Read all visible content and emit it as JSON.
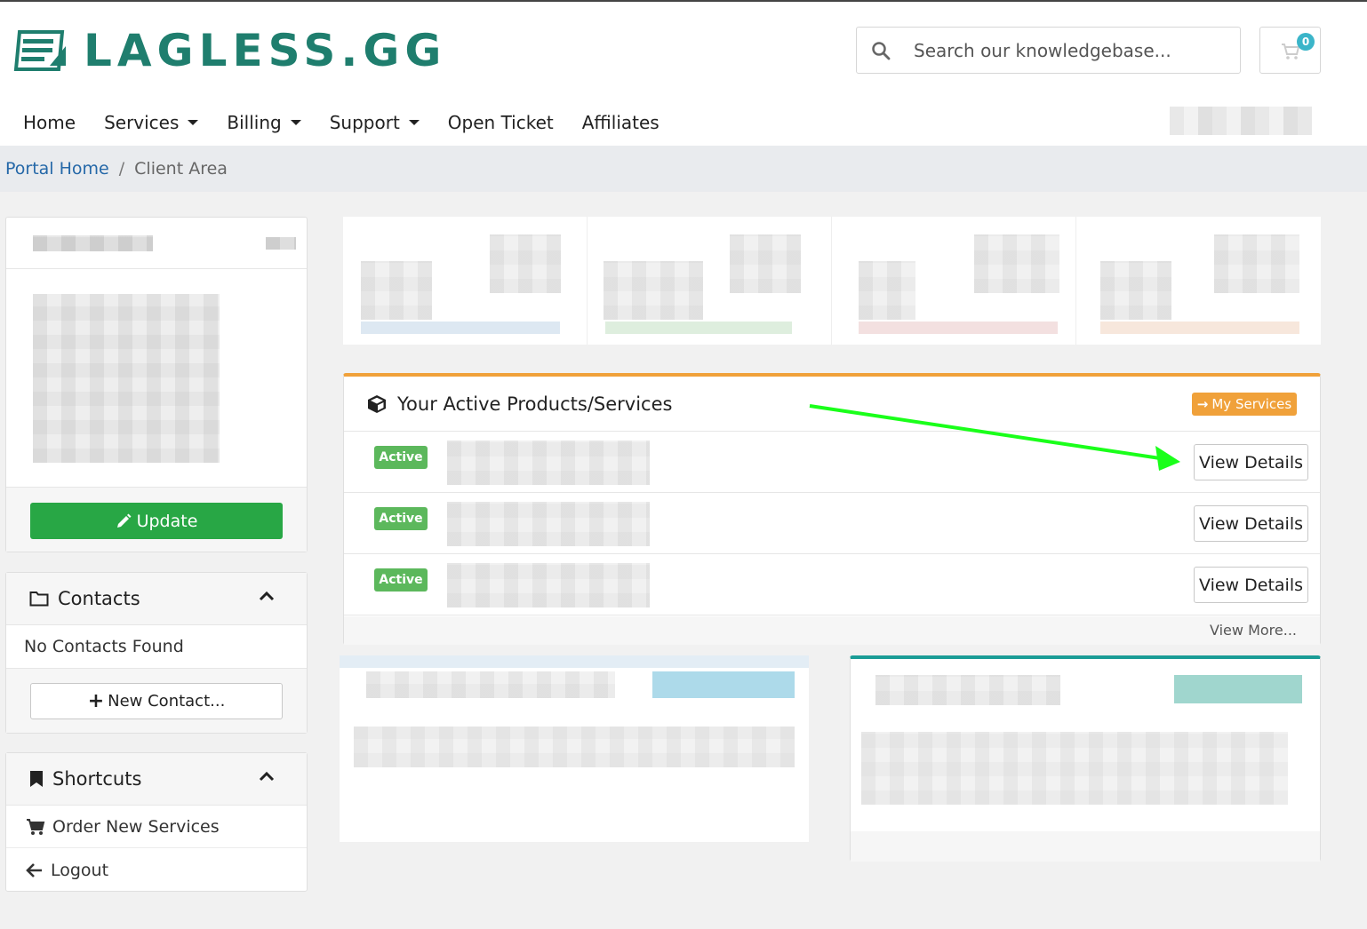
{
  "brand": {
    "name": "LAGLESS.GG",
    "color": "#1f7e6e"
  },
  "search": {
    "placeholder": "Search our knowledgebase..."
  },
  "cart": {
    "count": "0"
  },
  "nav": [
    {
      "label": "Home",
      "dropdown": false
    },
    {
      "label": "Services",
      "dropdown": true
    },
    {
      "label": "Billing",
      "dropdown": true
    },
    {
      "label": "Support",
      "dropdown": true
    },
    {
      "label": "Open Ticket",
      "dropdown": false
    },
    {
      "label": "Affiliates",
      "dropdown": false
    }
  ],
  "breadcrumb": {
    "home": "Portal Home",
    "separator": "/",
    "current": "Client Area"
  },
  "profile": {
    "update_label": "Update"
  },
  "contacts": {
    "title": "Contacts",
    "empty_text": "No Contacts Found",
    "new_label": "New Contact..."
  },
  "shortcuts": {
    "title": "Shortcuts",
    "items": [
      {
        "label": "Order New Services",
        "icon": "cart-icon"
      },
      {
        "label": "Logout",
        "icon": "arrow-left-icon"
      }
    ]
  },
  "products": {
    "title": "Your Active Products/Services",
    "my_services_label": "My Services",
    "rows": [
      {
        "status": "Active",
        "action": "View Details"
      },
      {
        "status": "Active",
        "action": "View Details"
      },
      {
        "status": "Active",
        "action": "View Details"
      }
    ],
    "view_more": "View More..."
  },
  "colors": {
    "accent_orange": "#f0a13a",
    "success": "#28a745",
    "active_badge": "#5cb85c",
    "link": "#2568a8",
    "teal": "#1a9c96",
    "annotation_arrow": "#1aff1a"
  }
}
